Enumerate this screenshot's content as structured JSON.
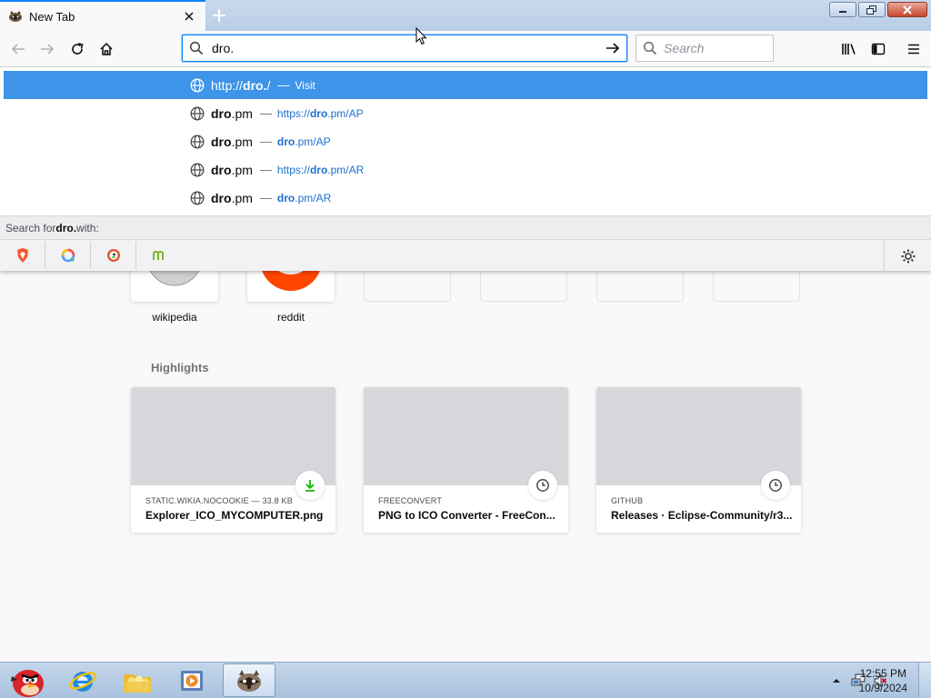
{
  "window": {
    "tab_title": "New Tab",
    "tab_favicon": "raccoon-icon",
    "controls": [
      "minimize-icon",
      "restore-icon",
      "close-icon"
    ]
  },
  "nav": {
    "back_icon": "arrow-left-icon",
    "forward_icon": "arrow-right-icon",
    "reload_icon": "reload-icon",
    "home_icon": "home-icon",
    "url_value": "dro.",
    "go_icon": "arrow-right-icon",
    "search_placeholder": "Search",
    "library_icon": "library-icon",
    "sidebar_icon": "sidebar-icon",
    "menu_icon": "hamburger-menu-icon"
  },
  "autocomplete": {
    "rows": [
      {
        "prefix": "http://",
        "match": "dro.",
        "suffix": "/",
        "sep": "—",
        "url_prefix": "",
        "url_match": "",
        "url_suffix": "",
        "action": "Visit",
        "selected": true
      },
      {
        "prefix": "",
        "match": "dro",
        "suffix": ".pm",
        "sep": "—",
        "url_prefix": "https://",
        "url_match": "dro",
        "url_suffix": ".pm/AP",
        "action": "",
        "selected": false
      },
      {
        "prefix": "",
        "match": "dro",
        "suffix": ".pm",
        "sep": "—",
        "url_prefix": "",
        "url_match": "dro",
        "url_suffix": ".pm/AP",
        "action": "",
        "selected": false
      },
      {
        "prefix": "",
        "match": "dro",
        "suffix": ".pm",
        "sep": "—",
        "url_prefix": "https://",
        "url_match": "dro",
        "url_suffix": ".pm/AR",
        "action": "",
        "selected": false
      },
      {
        "prefix": "",
        "match": "dro",
        "suffix": ".pm",
        "sep": "—",
        "url_prefix": "",
        "url_match": "dro",
        "url_suffix": ".pm/AR",
        "action": "",
        "selected": false
      }
    ],
    "search_with_prefix": "Search for ",
    "search_with_term": "dro.",
    "search_with_suffix": " with:",
    "engines": [
      "brave-icon",
      "qwant-icon",
      "duckduckgo-icon",
      "mojeek-icon"
    ],
    "settings_icon": "gear-icon"
  },
  "top_sites": [
    {
      "label": "wikipedia",
      "icon": "wikipedia-icon"
    },
    {
      "label": "reddit",
      "icon": "reddit-icon"
    },
    {
      "label": ""
    },
    {
      "label": ""
    },
    {
      "label": ""
    },
    {
      "label": ""
    }
  ],
  "highlights": {
    "heading": "Highlights",
    "cards": [
      {
        "source": "STATIC.WIKIA.NOCOOKIE — 33.8 KB",
        "title": "Explorer_ICO_MYCOMPUTER.png",
        "badge": "download-icon"
      },
      {
        "source": "FREECONVERT",
        "title": "PNG to ICO Converter - FreeCon...",
        "badge": "clock-icon"
      },
      {
        "source": "GITHUB",
        "title": "Releases · Eclipse-Community/r3...",
        "badge": "clock-icon"
      }
    ]
  },
  "taskbar": {
    "apps": [
      "angry-birds-icon",
      "internet-explorer-icon",
      "folder-icon",
      "media-player-icon",
      "raccoon-browser-icon"
    ],
    "tray": [
      "show-hidden-icons-icon",
      "network-icon",
      "volume-muted-icon"
    ],
    "time": "12:55 PM",
    "date": "10/9/2024"
  },
  "colors": {
    "accent": "#0a84ff",
    "selected_row": "#3d94e8",
    "url_text": "#1d6fce",
    "download_green": "#12bc00"
  }
}
